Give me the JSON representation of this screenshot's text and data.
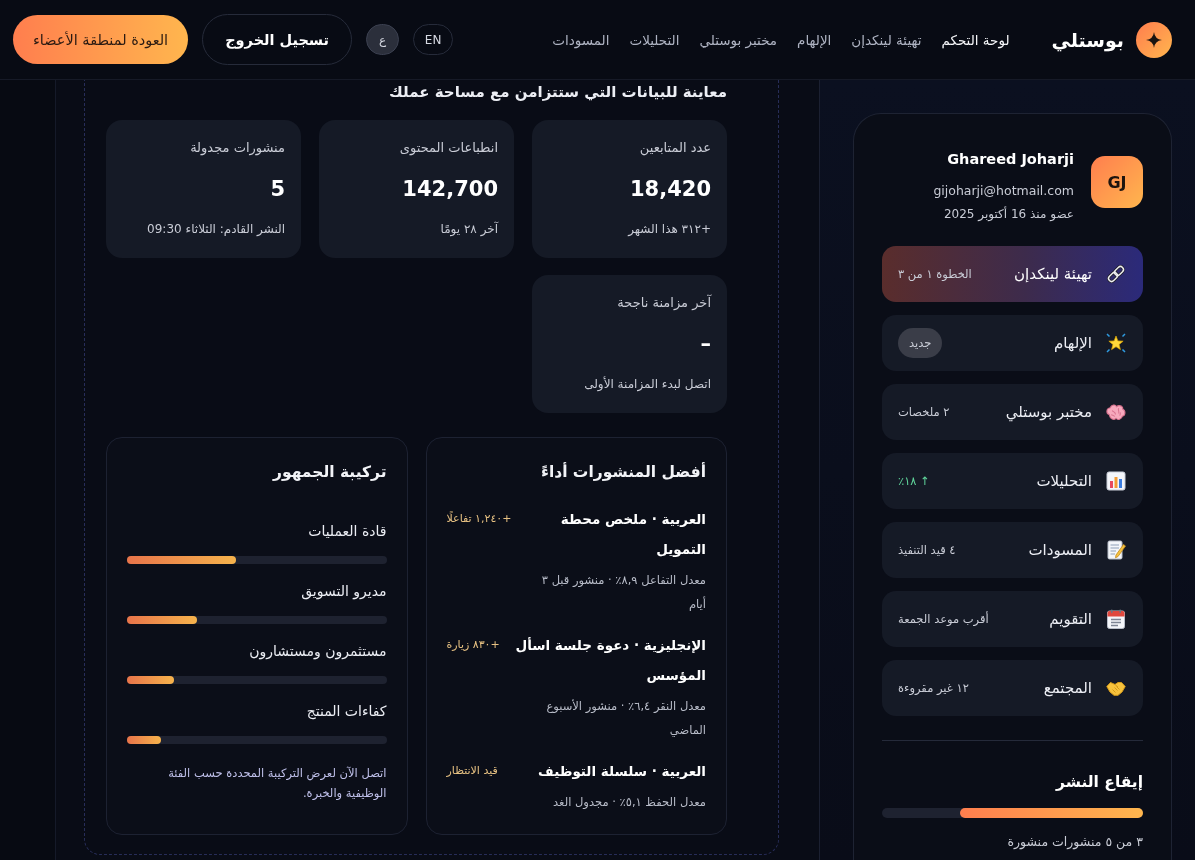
{
  "nav": {
    "brand": "بوستلي",
    "links": [
      {
        "label": "لوحة التحكم",
        "selected": true
      },
      {
        "label": "تهيئة لينكدإن",
        "selected": false
      },
      {
        "label": "الإلهام",
        "selected": false
      },
      {
        "label": "مختبر بوستلي",
        "selected": false
      },
      {
        "label": "التحليلات",
        "selected": false
      },
      {
        "label": "المسودات",
        "selected": false
      }
    ],
    "languages": [
      {
        "label": "EN",
        "selected": false
      },
      {
        "label": "ع",
        "selected": true
      }
    ],
    "logout_button": "تسجيل الخروج",
    "members_button": "العودة لمنطقة الأعضاء"
  },
  "preview": {
    "heading": "معاينة للبيانات التي ستتزامن مع مساحة عملك",
    "stats": [
      {
        "label": "عدد المتابعين",
        "value": "18,420",
        "note": "+٣١٢ هذا الشهر"
      },
      {
        "label": "انطباعات المحتوى",
        "value": "142,700",
        "note": "آخر ٢٨ يومًا"
      },
      {
        "label": "منشورات مجدولة",
        "value": "5",
        "note": "النشر القادم: الثلاثاء 09:30"
      },
      {
        "label": "آخر مزامنة ناجحة",
        "value": "–",
        "note": "اتصل لبدء المزامنة الأولى"
      }
    ],
    "top_posts": {
      "title": "أفضل المنشورات أداءً",
      "posts": [
        {
          "title": "العربية · ملخص محطة التمويل",
          "details": "معدل التفاعل ٨,٩٪ · منشور قبل ٣ أيام",
          "result": "+١,٢٤٠ تفاعلًا"
        },
        {
          "title": "الإنجليزية · دعوة جلسة اسأل المؤسس",
          "details": "معدل النقر ٦,٤٪ · منشور الأسبوع الماضي",
          "result": "+٨٣٠ زيارة"
        },
        {
          "title": "العربية · سلسلة التوظيف",
          "details": "معدل الحفظ ٥,١٪ · مجدول الغد",
          "result": "قيد الانتظار"
        }
      ]
    },
    "audience": {
      "title": "تركيبة الجمهور",
      "segments": [
        {
          "label": "قادة العمليات",
          "level": 0.42
        },
        {
          "label": "مديرو التسويق",
          "level": 0.27
        },
        {
          "label": "مستثمرون ومستشارون",
          "level": 0.18
        },
        {
          "label": "كفاءات المنتج",
          "level": 0.13
        }
      ],
      "note": "اتصل الآن لعرض التركيبة المحددة حسب الفئة الوظيفية والخبرة."
    }
  },
  "sidebar": {
    "profile": {
      "initials": "GJ",
      "name": "Ghareed Joharji",
      "email": "gijoharji@hotmail.com",
      "member_since": "عضو منذ 16 أكتوبر 2025"
    },
    "menu": [
      {
        "label": "تهيئة لينكدإن",
        "meta": "الخطوة ١ من ٣",
        "kind": "text",
        "selected": true
      },
      {
        "label": "الإلهام",
        "meta": "جديد",
        "kind": "badge",
        "selected": false
      },
      {
        "label": "مختبر بوستلي",
        "meta": "٢ ملخصات",
        "kind": "text",
        "selected": false
      },
      {
        "label": "التحليلات",
        "meta": "↑ ١٨٪",
        "kind": "trend",
        "selected": false
      },
      {
        "label": "المسودات",
        "meta": "٤ قيد التنفيذ",
        "kind": "text",
        "selected": false
      },
      {
        "label": "التقويم",
        "meta": "أقرب موعد الجمعة",
        "kind": "text",
        "selected": false
      },
      {
        "label": "المجتمع",
        "meta": "١٢ غير مقروءة",
        "kind": "text",
        "selected": false
      }
    ],
    "cadence": {
      "title": "إيقاع النشر",
      "level": 0.7,
      "caption": "٣ من ٥ منشورات منشورة"
    }
  }
}
